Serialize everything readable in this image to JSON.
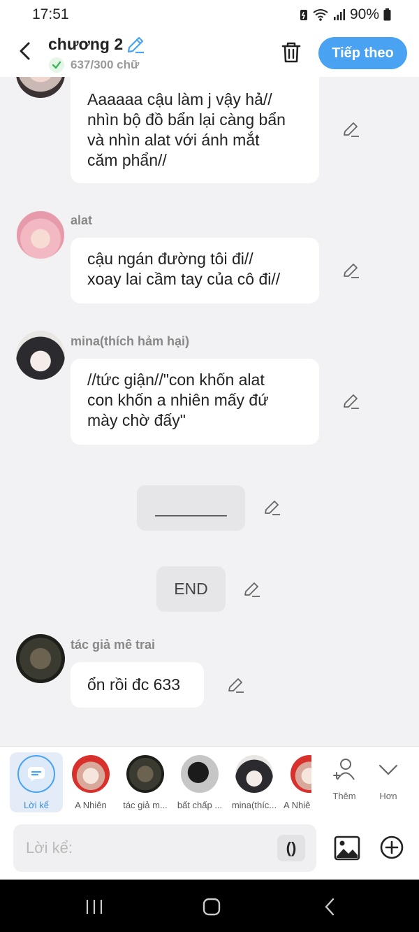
{
  "status_bar": {
    "time": "17:51",
    "battery": "90%"
  },
  "header": {
    "title": "chương 2",
    "word_count": "637/300 chữ",
    "next_label": "Tiếp theo"
  },
  "messages": [
    {
      "sender": "",
      "text": [
        "Aaaaaa cậu làm j vậy hả//",
        "nhìn bộ đồ bẩn lại càng bẩn",
        "và nhìn alat với ánh mắt",
        "căm phẩn//"
      ]
    },
    {
      "sender": "alat",
      "text": [
        "cậu ngán đường tôi đi//",
        "xoay lai cầm tay của cô đi//"
      ]
    },
    {
      "sender": "mina(thích hảm hại)",
      "text": [
        "//tức giận//\"con khốn alat",
        "con khốn a nhiên mấy đứ",
        "mày chờ đấy\""
      ]
    },
    {
      "sender": "",
      "text": [
        "________"
      ]
    },
    {
      "sender": "",
      "text": [
        "END"
      ]
    },
    {
      "sender": "tác giả mê trai",
      "text": [
        "ổn rồi đc 633"
      ]
    }
  ],
  "characters": [
    {
      "label": "Lời kể",
      "icon": "chat-bubble-icon"
    },
    {
      "label": "A Nhiên"
    },
    {
      "label": "tác giả m..."
    },
    {
      "label": "bất chấp ..."
    },
    {
      "label": "mina(thíc..."
    },
    {
      "label": "A Nhiê"
    }
  ],
  "tools": {
    "more_label": "Thêm",
    "expand_label": "Hơn"
  },
  "input": {
    "placeholder": "Lời kể:",
    "paren_label": "()"
  }
}
